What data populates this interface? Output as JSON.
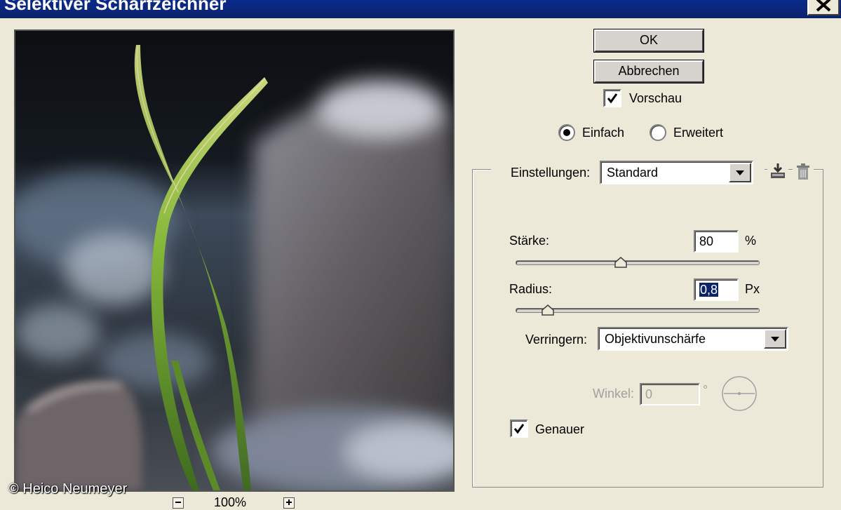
{
  "window": {
    "title": "Selektiver Scharfzeichner"
  },
  "buttons": {
    "ok": "OK",
    "cancel": "Abbrechen"
  },
  "preview_toggle": {
    "label": "Vorschau",
    "checked": true
  },
  "mode": {
    "simple": "Einfach",
    "advanced": "Erweitert",
    "selected": "Einfach"
  },
  "settings": {
    "label": "Einstellungen:",
    "value": "Standard"
  },
  "amount": {
    "label": "Stärke:",
    "value": "80",
    "unit": "%",
    "slider_fraction": 0.43
  },
  "radius": {
    "label": "Radius:",
    "value": "0,8",
    "unit": "Px",
    "slider_fraction": 0.13
  },
  "remove": {
    "label": "Verringern:",
    "value": "Objektivunschärfe"
  },
  "angle": {
    "label": "Winkel:",
    "value": "0",
    "unit": "°"
  },
  "more_accurate": {
    "label": "Genauer",
    "checked": true
  },
  "zoom": {
    "level": "100%"
  },
  "copyright": "© Heico Neumeyer"
}
